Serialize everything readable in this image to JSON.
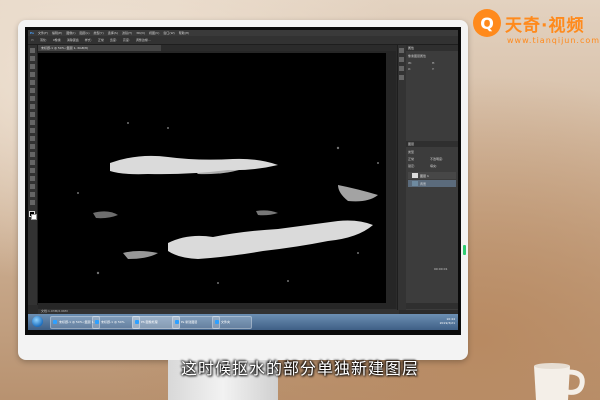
{
  "brand": {
    "mark": "Q",
    "name": "天奇·视频",
    "url": "www.tianqijun.com",
    "color": "#ff8a1c"
  },
  "photoshop": {
    "menu": [
      "文件(F)",
      "编辑(E)",
      "图像(I)",
      "图层(L)",
      "类型(Y)",
      "选择(S)",
      "滤镜(T)",
      "3D(D)",
      "视图(V)",
      "窗口(W)",
      "帮助(H)"
    ],
    "options": [
      "羽化:",
      "0像素",
      "消除锯齿",
      "样式:",
      "正常",
      "宽度:",
      "高度:",
      "调整边缘..."
    ],
    "document_tab": "未标题-1 @ 50% (图层 1, RGB/8)",
    "status": "文档:1.03M/2.06M",
    "panels": {
      "properties_tab": "属性",
      "properties_rows": [
        "像素图层属性",
        "W:",
        "H:",
        "X:",
        "Y:"
      ],
      "layers_tab": "图层",
      "layers_rows": [
        "类型",
        "正常",
        "不透明度:",
        "锁定:",
        "填充:"
      ],
      "layers": [
        {
          "name": "图层 1",
          "selected": false
        },
        {
          "name": "背景",
          "selected": true
        }
      ],
      "clock": "00:00:01"
    }
  },
  "taskbar": {
    "items": [
      {
        "label": "未标题-1 @ 50%",
        "active": false
      },
      {
        "label": "PS 图像处理",
        "active": true
      },
      {
        "label": "Ps 新建图层",
        "active": false
      },
      {
        "label": "文件夹",
        "active": false
      }
    ],
    "time": "10:44",
    "date": "2019/3/21"
  },
  "subtitle": "这时候抠水的部分单独新建图层"
}
